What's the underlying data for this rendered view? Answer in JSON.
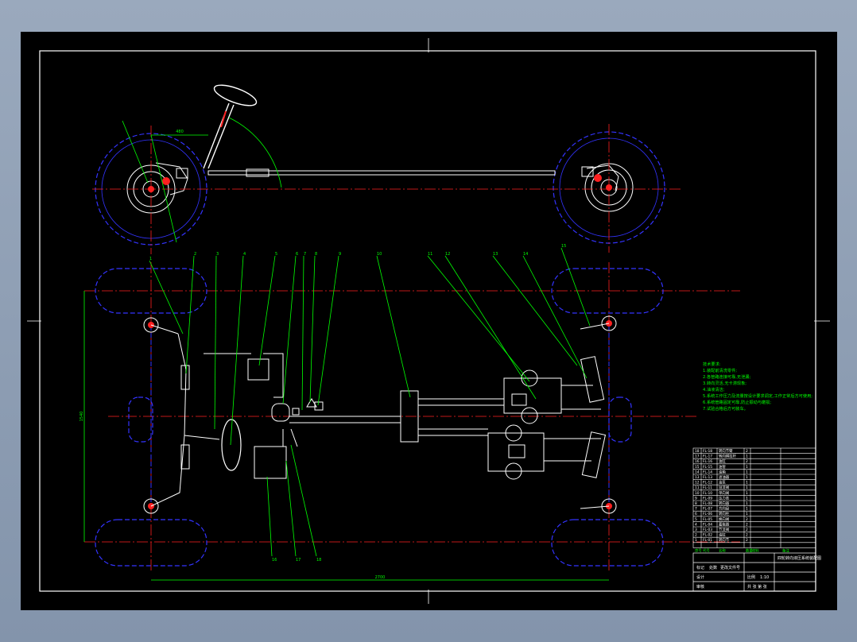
{
  "drawing": {
    "dimensions": {
      "wheelbase_top": "480",
      "wheelbase_bottom": "2700",
      "track_side": "1540"
    },
    "callouts": [
      "1",
      "2",
      "3",
      "4",
      "5",
      "6",
      "7",
      "8",
      "9",
      "10",
      "11",
      "12",
      "13",
      "14",
      "15",
      "16",
      "17",
      "18"
    ],
    "notes": [
      "技术要求:",
      "1.装配前清洗零件;",
      "2.各管路连接可靠,无泄漏;",
      "3.转向灵活,无卡滞现象;",
      "4.油液清洁;",
      "5.系统工作压力及流量按设计要求调定,工作正常后方可使用;",
      "6.系统管路固定可靠,防止振动与磨损;",
      "7.试验合格后方可装车。"
    ],
    "bom_rows": [
      {
        "no": "18",
        "code": "FL-18",
        "name": "转向节臂",
        "qty": "2"
      },
      {
        "no": "17",
        "code": "FL-17",
        "name": "转向横拉杆",
        "qty": "1"
      },
      {
        "no": "16",
        "code": "FL-16",
        "name": "油缸",
        "qty": "2"
      },
      {
        "no": "15",
        "code": "FL-15",
        "name": "油管",
        "qty": "1"
      },
      {
        "no": "14",
        "code": "FL-14",
        "name": "油箱",
        "qty": "1"
      },
      {
        "no": "13",
        "code": "FL-13",
        "name": "滤油器",
        "qty": "1"
      },
      {
        "no": "12",
        "code": "FL-12",
        "name": "油泵",
        "qty": "1"
      },
      {
        "no": "11",
        "code": "FL-11",
        "name": "溢流阀",
        "qty": "1"
      },
      {
        "no": "10",
        "code": "FL-10",
        "name": "单向阀",
        "qty": "1"
      },
      {
        "no": "9",
        "code": "FL-09",
        "name": "压力表",
        "qty": "1"
      },
      {
        "no": "8",
        "code": "FL-08",
        "name": "转向器",
        "qty": "1"
      },
      {
        "no": "7",
        "code": "FL-07",
        "name": "方向盘",
        "qty": "1"
      },
      {
        "no": "6",
        "code": "FL-06",
        "name": "转向柱",
        "qty": "1"
      },
      {
        "no": "5",
        "code": "FL-05",
        "name": "换向阀",
        "qty": "2"
      },
      {
        "no": "4",
        "code": "FL-04",
        "name": "蓄能器",
        "qty": "2"
      },
      {
        "no": "3",
        "code": "FL-03",
        "name": "节流阀",
        "qty": "2"
      },
      {
        "no": "2",
        "code": "FL-02",
        "name": "油缸",
        "qty": "2"
      },
      {
        "no": "1",
        "code": "FL-01",
        "name": "转向节",
        "qty": "2"
      }
    ],
    "bom_header": [
      "序号",
      "代号",
      "名称",
      "数量",
      "材料",
      "备注"
    ],
    "title_block": {
      "title": "四轮转向液压系统装配图",
      "labels": [
        "标记",
        "处数",
        "更改文件号",
        "签字",
        "日期",
        "设计",
        "审核",
        "工艺",
        "批准"
      ],
      "scale_label": "比例",
      "scale": "1:10",
      "sheet": "共 张 第 张"
    }
  },
  "colors": {
    "background": "#000000",
    "frame": "#ffffff",
    "centerline": "#ff2020",
    "tire": "#3333ff",
    "leader": "#00ff00",
    "text": "#00ff00"
  }
}
